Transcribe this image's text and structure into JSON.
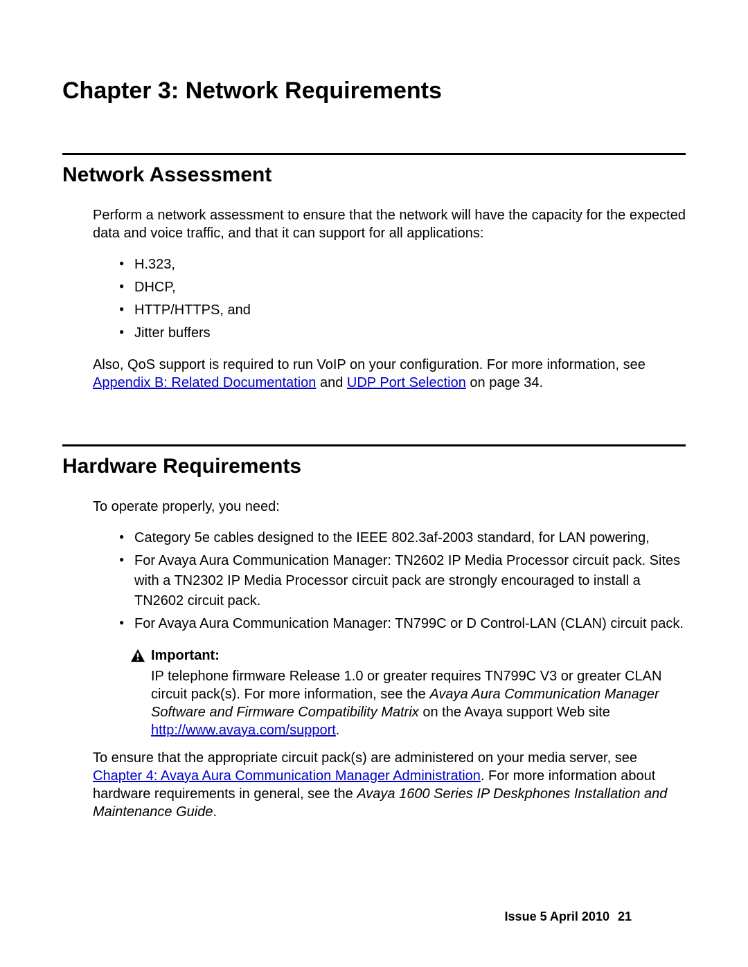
{
  "chapter": {
    "title": "Chapter 3:   Network Requirements"
  },
  "section1": {
    "heading": "Network Assessment",
    "para1": "Perform a network assessment to ensure that the network will have the capacity for the expected data and voice traffic, and that it can support for all applications:",
    "bullets": {
      "b0": "H.323,",
      "b1": "DHCP,",
      "b2": "HTTP/HTTPS, and",
      "b3": "Jitter buffers"
    },
    "para2_pre": "Also, QoS support is required to run VoIP on your configuration. For more information, see ",
    "link1": "Appendix B: Related Documentation",
    "para2_mid": " and ",
    "link2": "UDP Port Selection",
    "para2_post": " on page 34."
  },
  "section2": {
    "heading": "Hardware Requirements",
    "para1": "To operate properly, you need:",
    "bullets": {
      "b0": "Category 5e cables designed to the IEEE 802.3af-2003 standard, for LAN powering,",
      "b1": "For Avaya Aura Communication Manager: TN2602 IP Media Processor circuit pack. Sites with a TN2302 IP Media Processor circuit pack are strongly encouraged to install a TN2602 circuit pack.",
      "b2": "For Avaya Aura Communication Manager: TN799C or D Control-LAN (CLAN) circuit pack."
    },
    "important": {
      "label": "Important:",
      "text_pre": "IP telephone firmware Release 1.0 or greater requires TN799C V3 or greater CLAN circuit pack(s). For more information, see the ",
      "italic": "Avaya Aura Communication Manager Software and Firmware Compatibility Matrix",
      "text_post": " on the Avaya support Web site",
      "link": "http://www.avaya.com/support",
      "period": "."
    },
    "para2_pre": "To ensure that the appropriate circuit pack(s) are administered on your media server, see ",
    "link1": "Chapter 4: Avaya Aura Communication Manager Administration",
    "para2_mid": ". For more information about hardware requirements in general, see the ",
    "italic": "Avaya 1600 Series IP Deskphones Installation and Maintenance Guide",
    "para2_post": "."
  },
  "footer": {
    "issue": "Issue 5   April 2010",
    "page": "21"
  }
}
